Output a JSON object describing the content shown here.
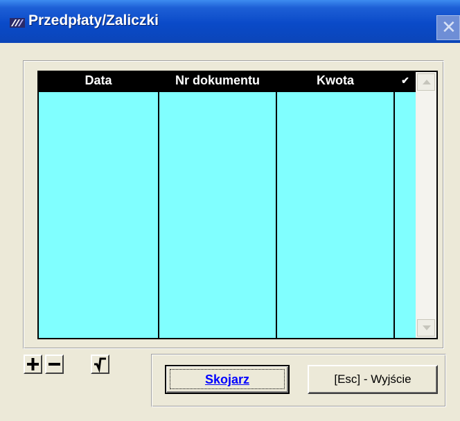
{
  "window": {
    "title": "Przedpłaty/Zaliczki",
    "close_glyph": "✕",
    "title_bar_color": "#0b4ac8",
    "background": "#ece9d8"
  },
  "grid": {
    "columns": [
      "Data",
      "Nr dokumentu",
      "Kwota",
      "✔"
    ],
    "rows": [],
    "row_color": "#80ffff",
    "header_color": "#000000"
  },
  "toolbar": {
    "add_icon": "plus-icon",
    "remove_icon": "minus-icon",
    "confirm_icon": "check-arrow-icon"
  },
  "buttons": {
    "associate_label": "Skojarz",
    "exit_label": "[Esc] - Wyjście"
  }
}
